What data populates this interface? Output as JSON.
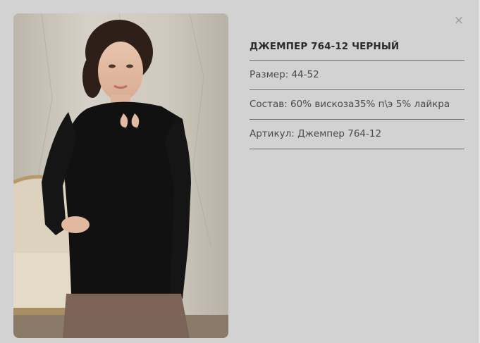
{
  "product": {
    "title": "ДЖЕМПЕР 764-12 ЧЕРНЫЙ",
    "size_label": "Размер:",
    "size_value": "44-52",
    "composition_label": "Состав:",
    "composition_value": "60% вискоза35% п\\э 5% лайкра",
    "article_label": "Артикул:",
    "article_value": "Джемпер 764-12"
  },
  "controls": {
    "close_label": "×"
  },
  "image": {
    "subject": "model-wearing-black-jumper"
  }
}
